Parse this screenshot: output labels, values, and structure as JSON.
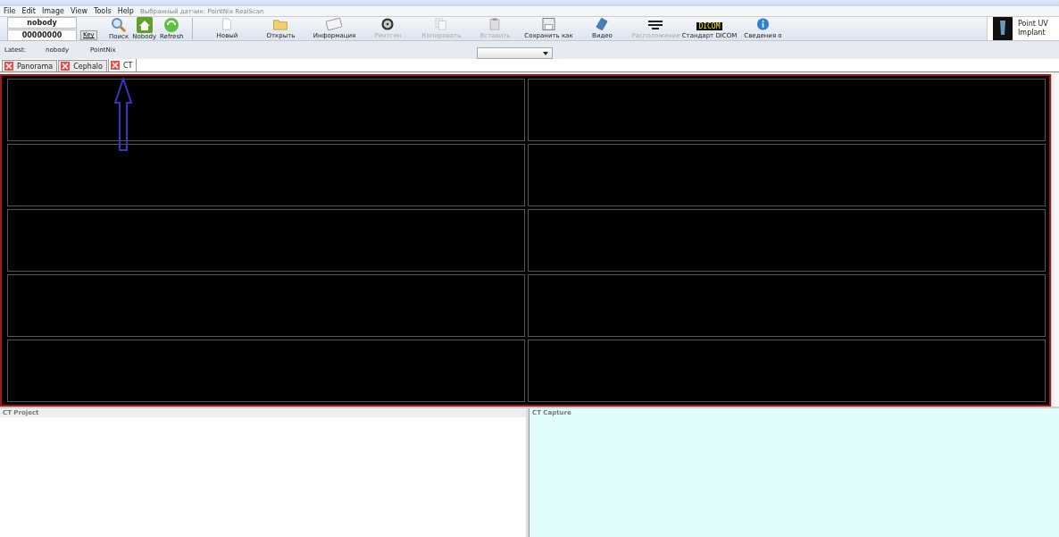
{
  "menu": [
    "File",
    "Edit",
    "Image",
    "View",
    "Tools",
    "Help"
  ],
  "sensor_label": "Выбранный датчик: PointNix RealScan",
  "patient": {
    "name": "nobody",
    "id": "00000000",
    "key_button": "Key"
  },
  "quick_buttons": [
    {
      "label": "Поиск",
      "kind": "search"
    },
    {
      "label": "Nobody",
      "kind": "home"
    },
    {
      "label": "Refresh",
      "kind": "refresh"
    }
  ],
  "toolbar": [
    {
      "label": "Новый",
      "kind": "new",
      "disabled": false
    },
    {
      "label": "Открыть",
      "kind": "open",
      "disabled": false
    },
    {
      "label": "Информация",
      "kind": "info",
      "disabled": false
    },
    {
      "label": "Рентген",
      "kind": "xray",
      "disabled": true
    },
    {
      "label": "Копировать",
      "kind": "copy",
      "disabled": true
    },
    {
      "label": "Вставить",
      "kind": "paste",
      "disabled": true
    },
    {
      "label": "Сохранить как",
      "kind": "save",
      "disabled": false
    },
    {
      "label": "Видео",
      "kind": "video",
      "disabled": false
    },
    {
      "label": "Расположение",
      "kind": "layout",
      "disabled": true
    },
    {
      "label": "Стандарт DICOM",
      "kind": "dicom",
      "disabled": false,
      "badge": "DICOM"
    },
    {
      "label": "Сведения о",
      "kind": "about",
      "disabled": false
    }
  ],
  "product": {
    "line1": "Point UV",
    "line2": "Implant"
  },
  "latest": {
    "label": "Latest:",
    "patient": "nobody",
    "sensor": "PointNix"
  },
  "tabs": [
    {
      "label": "Panorama",
      "selected": false
    },
    {
      "label": "Cephalo",
      "selected": false
    },
    {
      "label": "CT",
      "selected": true
    }
  ],
  "panels": [
    {
      "title": "CT Project",
      "kind": "project"
    },
    {
      "title": "CT Capture",
      "kind": "capture"
    }
  ]
}
